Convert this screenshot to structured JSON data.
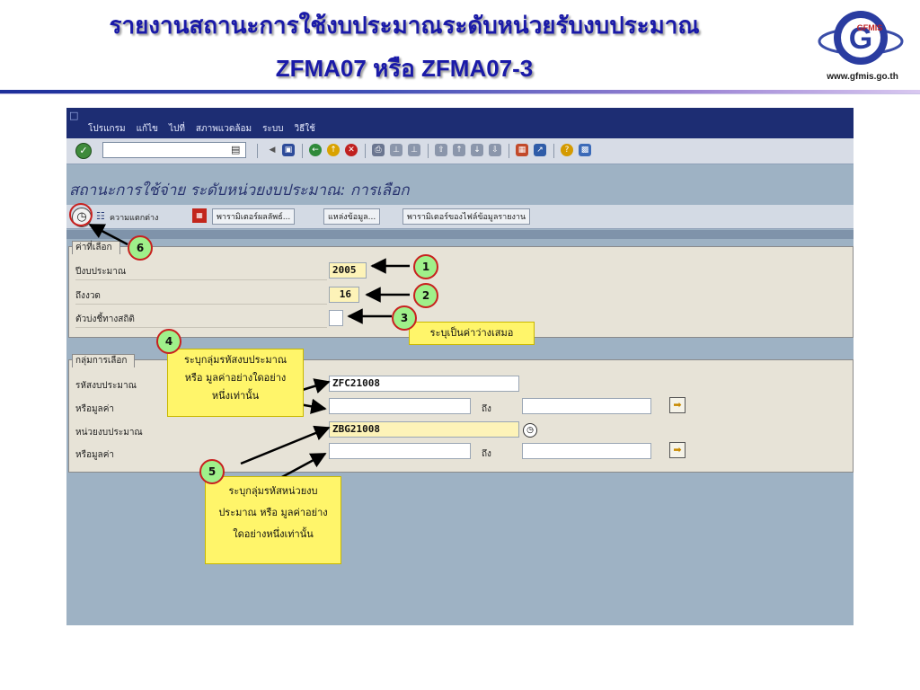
{
  "slide": {
    "title_line1": "รายงานสถานะการใช้งบประมาณระดับหน่วยรับงบประมาณ",
    "title_line2": "ZFMA07 หรือ ZFMA07-3",
    "logo_url": "www.gfmis.go.th",
    "logo_text": "GFMIS"
  },
  "sap": {
    "menu": [
      "โปรแกรม",
      "แก้ไข",
      "ไปที่",
      "สภาพแวดล้อม",
      "ระบบ",
      "วิธีใช้"
    ],
    "screen_title": "สถานะการใช้จ่าย ระดับหน่วยงบประมาณ: การเลือก",
    "app_toolbar": {
      "diff_label": "ความแตกต่าง",
      "result_params": "พารามิเตอร์ผลลัพธ์...",
      "data_source": "แหล่งข้อมูล...",
      "file_params": "พารามิเตอร์ของไฟล์ข้อมูลรายงาน"
    },
    "selection": {
      "group_label": "ค่าที่เลือก",
      "fiscal_year_label": "ปีงบประมาณ",
      "fiscal_year_value": "2005",
      "period_label": "ถึงงวด",
      "period_value": "16",
      "stat_indicator_label": "ตัวบ่งชี้ทางสถิติ",
      "stat_indicator_value": ""
    },
    "selection_group": {
      "group_label": "กลุ่มการเลือก",
      "budget_code_label": "รหัสงบประมาณ",
      "budget_code_value": "ZFC21008",
      "or_value_label_1": "หรือมูลค่า",
      "to_label_1": "ถึง",
      "budget_unit_label": "หน่วยงบประมาณ",
      "budget_unit_value": "ZBG21008",
      "or_value_label_2": "หรือมูลค่า",
      "to_label_2": "ถึง"
    }
  },
  "annotations": {
    "badges": [
      "1",
      "2",
      "3",
      "4",
      "5",
      "6"
    ],
    "callout_3": "ระบุเป็นค่าว่างเสมอ",
    "callout_4": [
      "ระบุกลุ่มรหัสงบประมาณ",
      "หรือ มูลค่าอย่างใดอย่าง",
      "หนึ่งเท่านั้น"
    ],
    "callout_5": [
      "ระบุกลุ่มรหัสหน่วยงบ",
      "ประมาณ หรือ มูลค่าอย่าง",
      "ใดอย่างหนึ่งเท่านั้น"
    ]
  }
}
